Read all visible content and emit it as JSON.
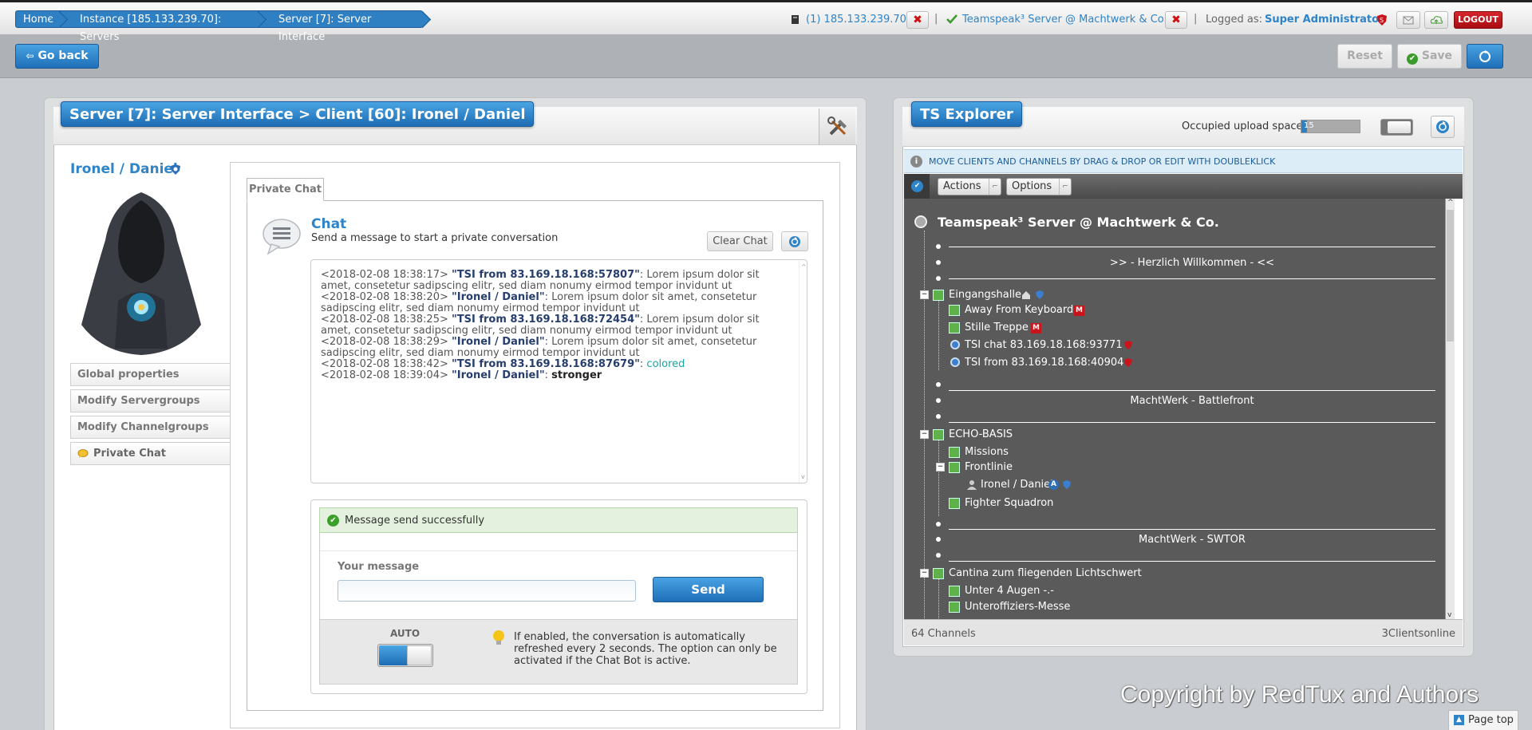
{
  "topbar": {
    "breadcrumbs": [
      "Home",
      "Instance [185.133.239.70]: Servers",
      "Server [7]: Server Interface"
    ],
    "instance_link": "(1) 185.133.239.70",
    "server_link": "Teamspeak³ Server @ Machtwerk & Co.",
    "logged_as_label": "Logged as:",
    "logged_as_user": "Super Administrator",
    "logout_label": "LOGOUT"
  },
  "toolbar": {
    "go_back_label": "Go back",
    "reset_label": "Reset",
    "save_label": "Save"
  },
  "left_panel": {
    "title": "Server [7]: Server Interface > Client [60]: Ironel / Daniel",
    "client_name": "Ironel / Daniel",
    "nav_items": [
      "Global properties",
      "Modify Servergroups",
      "Modify Channelgroups",
      "Private Chat"
    ],
    "tab_label": "Private Chat",
    "chat_title": "Chat",
    "chat_subtitle": "Send a message to start a private conversation",
    "clear_chat_label": "Clear Chat",
    "messages": [
      {
        "ts": "<2018-02-08 18:38:17>",
        "sender": "\"TSI from 83.169.18.168:57807\"",
        "text": ": Lorem ipsum dolor sit amet, consetetur sadipscing elitr, sed diam nonumy eirmod tempor invidunt ut"
      },
      {
        "ts": "<2018-02-08 18:38:20>",
        "sender": "\"Ironel / Daniel\"",
        "text": ": Lorem ipsum dolor sit amet, consetetur sadipscing elitr, sed diam nonumy eirmod tempor invidunt ut"
      },
      {
        "ts": "<2018-02-08 18:38:25>",
        "sender": "\"TSI from 83.169.18.168:72454\"",
        "text": ": Lorem ipsum dolor sit amet, consetetur sadipscing elitr, sed diam nonumy eirmod tempor invidunt ut"
      },
      {
        "ts": "<2018-02-08 18:38:29>",
        "sender": "\"Ironel / Daniel\"",
        "text": ": Lorem ipsum dolor sit amet, consetetur sadipscing elitr, sed diam nonumy eirmod tempor invidunt ut"
      },
      {
        "ts": "<2018-02-08 18:38:42>",
        "sender": "\"TSI from 83.169.18.168:87679\"",
        "text": ": ",
        "styled": "colored",
        "style": "colored"
      },
      {
        "ts": "<2018-02-08 18:39:04>",
        "sender": "\"Ironel / Daniel\"",
        "text": ": ",
        "styled": "stronger",
        "style": "bold"
      }
    ],
    "success_message": "Message send successfully",
    "your_message_label": "Your message",
    "message_value": "",
    "send_label": "Send",
    "auto_label": "AUTO",
    "auto_enabled": true,
    "auto_hint": "If enabled, the conversation is automatically refreshed every 2 seconds. The option can only be activated if the Chat Bot is active."
  },
  "explorer": {
    "title": "TS Explorer",
    "upload_label": "Occupied upload space",
    "upload_value": "15",
    "upload_fraction": 0.1,
    "hint": "MOVE CLIENTS AND CHANNELS BY DRAG & DROP OR EDIT WITH DOUBLEKLICK",
    "actions_label": "Actions",
    "options_label": "Options",
    "server_name": "Teamspeak³ Server @ Machtwerk & Co.",
    "tree": {
      "spacer1": ">> - Herzlich Willkommen - <<",
      "ch_eingangshalle": "Eingangshalle",
      "ch_afk": "Away From Keyboard",
      "ch_stille": "Stille Treppe",
      "cl_tsi_chat": "TSI chat 83.169.18.168:93771",
      "cl_tsi_from": "TSI from 83.169.18.168:40904",
      "spacer2": "MachtWerk - Battlefront",
      "ch_echo": "ECHO-BASIS",
      "ch_missions": "Missions",
      "ch_frontlinie": "Frontlinie",
      "cl_ironel": "Ironel / Daniel",
      "ch_fighter": "Fighter Squadron",
      "spacer3": "MachtWerk - SWTOR",
      "ch_cantina": "Cantina zum fliegenden Lichtschwert",
      "ch_unter4": "Unter 4 Augen -.-",
      "ch_unteroff": "Unteroffiziers-Messe"
    },
    "channels_count": "64 Channels",
    "clients_online": "3Clientsonline"
  },
  "footer": {
    "copyright": "Copyright by RedTux and Authors",
    "page_top": "Page top"
  },
  "colors": {
    "accent": "#2f7fc3",
    "danger": "#c8141a",
    "success_bg": "#e3f1de",
    "tree_bg": "#5a5a5a"
  }
}
